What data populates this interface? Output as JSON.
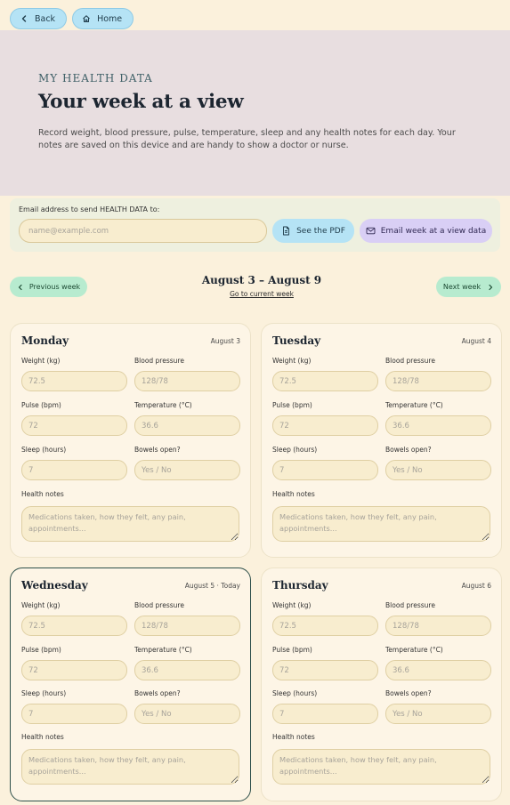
{
  "nav": {
    "back_label": "Back",
    "home_label": "Home"
  },
  "hero": {
    "eyebrow": "MY HEALTH DATA",
    "title": "Your week at a view",
    "description": "Record weight, blood pressure, pulse, temperature, sleep and any health notes for each day. Your notes are saved on this device and are handy to show a doctor or nurse."
  },
  "email": {
    "label": "Email address to send HEALTH DATA to:",
    "placeholder": "name@example.com",
    "value": "",
    "pdf_label": "See the PDF",
    "send_label": "Email week at a view data"
  },
  "week": {
    "prev_label": "Previous week",
    "next_label": "Next week",
    "range": "August 3 – August 9",
    "current_link": "Go to current week"
  },
  "field_labels": {
    "weight": "Weight (kg)",
    "bp": "Blood pressure",
    "pulse": "Pulse (bpm)",
    "temp": "Temperature (°C)",
    "sleep": "Sleep (hours)",
    "bowels": "Bowels open?",
    "notes": "Health notes"
  },
  "placeholders": {
    "weight": "72.5",
    "bp": "128/78",
    "pulse": "72",
    "temp": "36.6",
    "sleep": "7",
    "bowels": "Yes / No",
    "notes": "Medications taken, how they felt, any pain, appointments..."
  },
  "days": [
    {
      "name": "Monday",
      "date": "August 3",
      "today": false
    },
    {
      "name": "Tuesday",
      "date": "August 4",
      "today": false
    },
    {
      "name": "Wednesday",
      "date": "August 5 · Today",
      "today": true
    },
    {
      "name": "Thursday",
      "date": "August 6",
      "today": false
    }
  ],
  "colors": {
    "page_bg": "#fbf1dc",
    "hero_bg": "#e8dee0",
    "nav_pill": "#b5e3f5",
    "week_pill": "#b7ebcf",
    "email_button": "#d9cff5",
    "today_border": "#2d4f4a"
  }
}
